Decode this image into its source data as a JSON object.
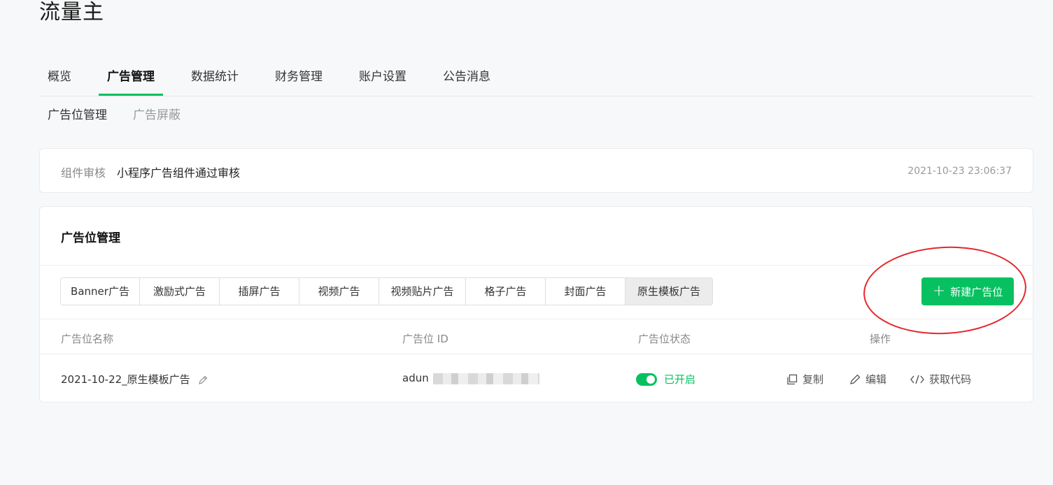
{
  "app": {
    "title": "流量主"
  },
  "main_tabs": [
    {
      "label": "概览"
    },
    {
      "label": "广告管理",
      "active": true
    },
    {
      "label": "数据统计"
    },
    {
      "label": "财务管理"
    },
    {
      "label": "账户设置"
    },
    {
      "label": "公告消息"
    }
  ],
  "sub_tabs": [
    {
      "label": "广告位管理",
      "active": true
    },
    {
      "label": "广告屏蔽"
    }
  ],
  "notice": {
    "label": "组件审核",
    "text": "小程序广告组件通过审核",
    "time": "2021-10-23 23:06:37"
  },
  "ad_management": {
    "title": "广告位管理",
    "ad_types": [
      {
        "label": "Banner广告"
      },
      {
        "label": "激励式广告"
      },
      {
        "label": "插屏广告"
      },
      {
        "label": "视频广告"
      },
      {
        "label": "视频贴片广告"
      },
      {
        "label": "格子广告"
      },
      {
        "label": "封面广告"
      },
      {
        "label": "原生模板广告",
        "active": true
      }
    ],
    "new_button": {
      "icon": "+",
      "label": "新建广告位"
    },
    "columns": [
      "广告位名称",
      "广告位 ID",
      "广告位状态",
      "操作"
    ],
    "rows": [
      {
        "name": "2021-10-22_原生模板广告",
        "id_visible": "adun",
        "status": "已开启",
        "actions": {
          "copy": "复制",
          "edit": "编辑",
          "code": "获取代码"
        }
      }
    ]
  },
  "colors": {
    "accent": "#07c160",
    "annotation": "#e5262b"
  }
}
